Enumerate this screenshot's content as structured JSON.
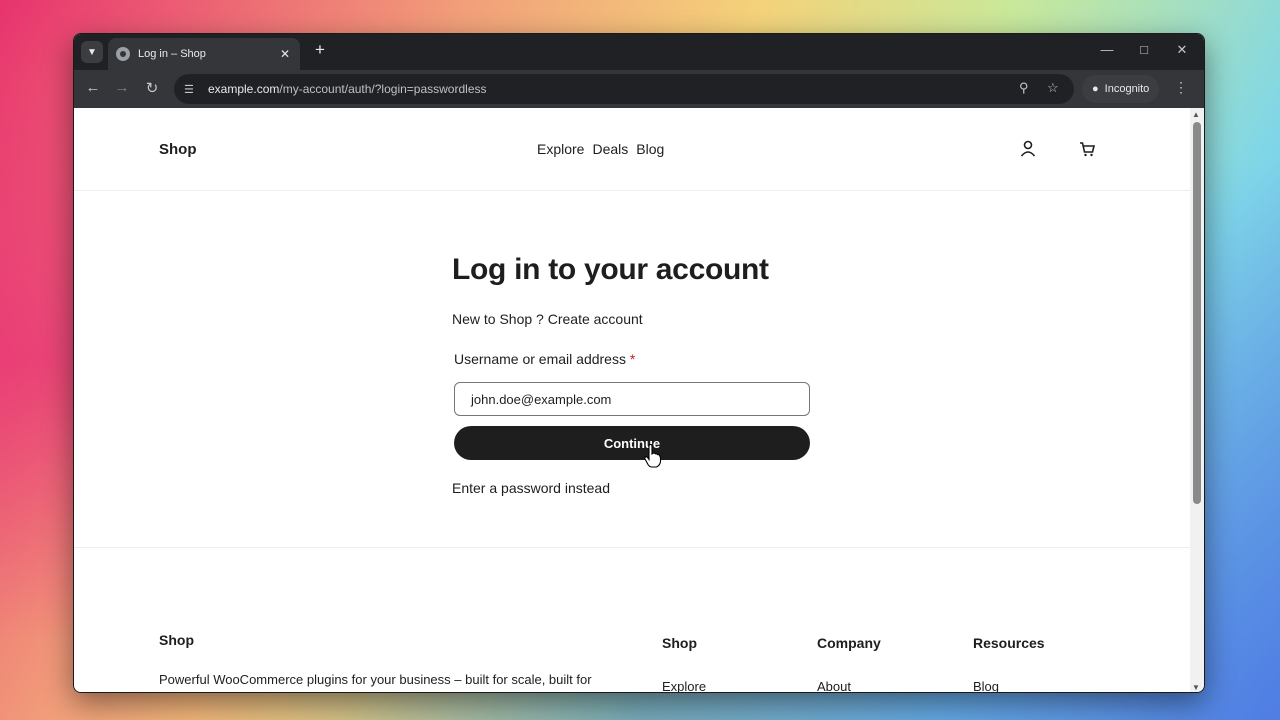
{
  "browser": {
    "tab_title": "Log in – Shop",
    "url_host": "example.com",
    "url_path": "/my-account/auth/?login=passwordless",
    "incognito_label": "Incognito"
  },
  "header": {
    "logo": "Shop",
    "nav": [
      "Explore",
      "Deals",
      "Blog"
    ]
  },
  "login": {
    "title": "Log in to your account",
    "signup_text": "New to Shop ? Create account",
    "field_label": "Username or email address",
    "required_mark": "*",
    "email_value": "john.doe@example.com",
    "continue_label": "Continue",
    "alt_link": "Enter a password instead"
  },
  "footer": {
    "logo": "Shop",
    "description": "Powerful WooCommerce plugins for your business – built for scale, built for",
    "columns": [
      {
        "title": "Shop",
        "first_link": "Explore"
      },
      {
        "title": "Company",
        "first_link": "About"
      },
      {
        "title": "Resources",
        "first_link": "Blog"
      }
    ]
  },
  "icons": [
    "tab-search-icon",
    "globe-icon",
    "close-icon",
    "plus-icon",
    "minimize-icon",
    "maximize-icon",
    "back-icon",
    "forward-icon",
    "reload-icon",
    "site-info-icon",
    "zoom-icon",
    "star-icon",
    "incognito-icon",
    "more-icon",
    "account-icon",
    "cart-icon",
    "pointer-cursor-icon"
  ]
}
